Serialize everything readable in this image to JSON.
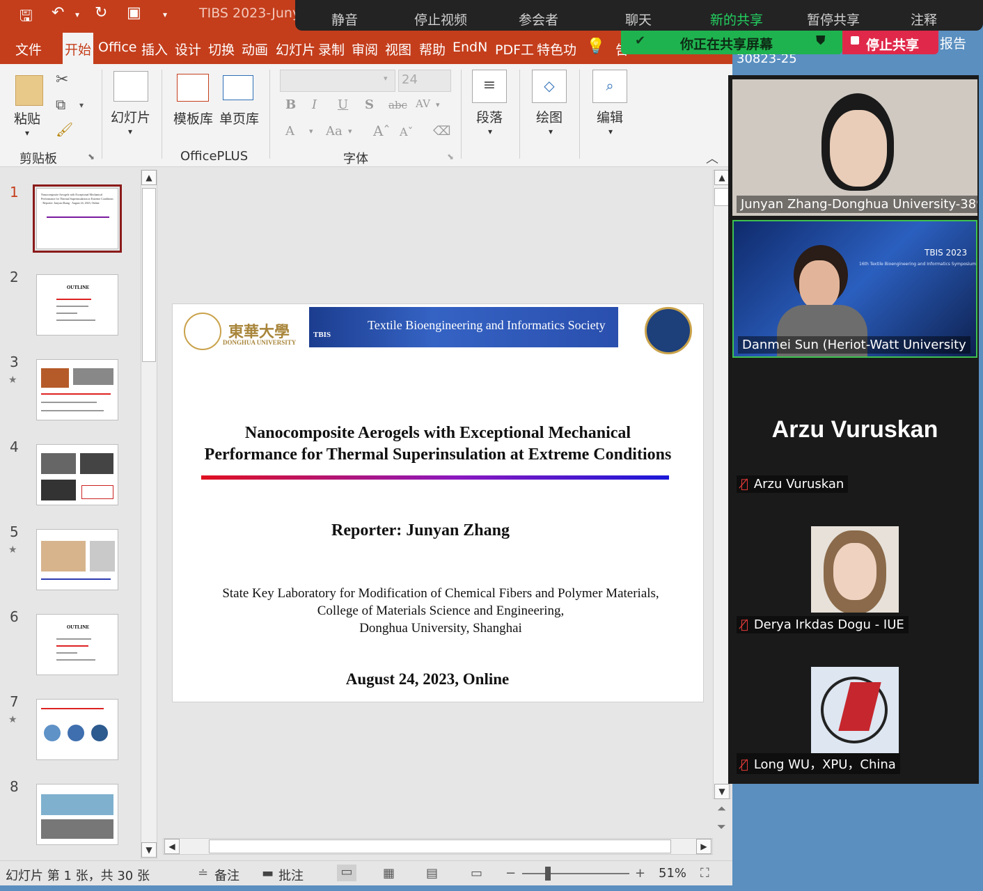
{
  "ppt": {
    "title": "TIBS 2023-Juny",
    "menu": [
      "文件",
      "开始",
      "Office",
      "插入",
      "设计",
      "切换",
      "动画",
      "幻灯片",
      "录制",
      "审阅",
      "视图",
      "帮助",
      "EndN",
      "PDF工",
      "特色功",
      "告"
    ],
    "ribbon": {
      "paste": "粘贴",
      "clipboard": "剪贴板",
      "slides": "幻灯片",
      "template_lib": "模板库",
      "single_page_lib": "单页库",
      "officeplus": "OfficePLUS",
      "font_size": "24",
      "font_group": "字体",
      "paragraph": "段落",
      "drawing": "绘图",
      "editing": "编辑"
    },
    "status": {
      "slide_info": "幻灯片 第 1 张，共 30 张",
      "notes": "备注",
      "comments": "批注",
      "zoom": "51%"
    }
  },
  "thumbnails": [
    {
      "num": "1",
      "text": "Nanocomposite Aerogels with Exceptional Mechanical Performance for Thermal Superinsulation at Extreme Conditions · Reporter: Junyan Zhang · August 24, 2023, Online",
      "star": false
    },
    {
      "num": "2",
      "text": "OUTLINE",
      "star": false
    },
    {
      "num": "3",
      "text": "",
      "star": true
    },
    {
      "num": "4",
      "text": "",
      "star": true
    },
    {
      "num": "5",
      "text": "",
      "star": true
    },
    {
      "num": "6",
      "text": "OUTLINE",
      "star": false
    },
    {
      "num": "7",
      "text": "",
      "star": true
    },
    {
      "num": "8",
      "text": "",
      "star": false
    }
  ],
  "slide": {
    "logo_left": "東華大學",
    "logo_left_sub": "DONGHUA UNIVERSITY",
    "banner": "Textile Bioengineering and Informatics Society",
    "banner_tag": "TBIS",
    "title_line1": "Nanocomposite Aerogels with Exceptional Mechanical",
    "title_line2": "Performance for Thermal Superinsulation at Extreme Conditions",
    "reporter": "Reporter:  Junyan Zhang",
    "affil_line1": "State Key Laboratory for Modification of Chemical Fibers and Polymer Materials,",
    "affil_line2": "College of Materials Science and Engineering,",
    "affil_line3": "Donghua University, Shanghai",
    "date": "August 24, 2023, Online"
  },
  "zoom_toolbar": {
    "items": [
      "静音",
      "停止视频",
      "参会者",
      "聊天",
      "新的共享",
      "暂停共享",
      "注释"
    ],
    "sharing_notice": "你正在共享屏幕",
    "stop_share": "停止共享",
    "bg_text_1": "30823-25",
    "bg_text_2": "报告"
  },
  "participants": [
    {
      "name": "Junyan Zhang-Donghua University-389",
      "muted": false
    },
    {
      "name": "Danmei Sun (Heriot-Watt University",
      "muted": false,
      "overlay_title": "TBIS 2023",
      "overlay_sub": "16th Textile Bioengineering and Informatics Symposium"
    },
    {
      "name": "Arzu Vuruskan",
      "muted": true,
      "big_name": "Arzu Vuruskan"
    },
    {
      "name": "Derya Irkdas Dogu - IUE",
      "muted": true
    },
    {
      "name": "Long WU，XPU，China",
      "muted": true
    }
  ],
  "colors": {
    "ppt_accent": "#c43e1c",
    "zoom_green": "#1fb34f",
    "zoom_red": "#e0294a"
  }
}
